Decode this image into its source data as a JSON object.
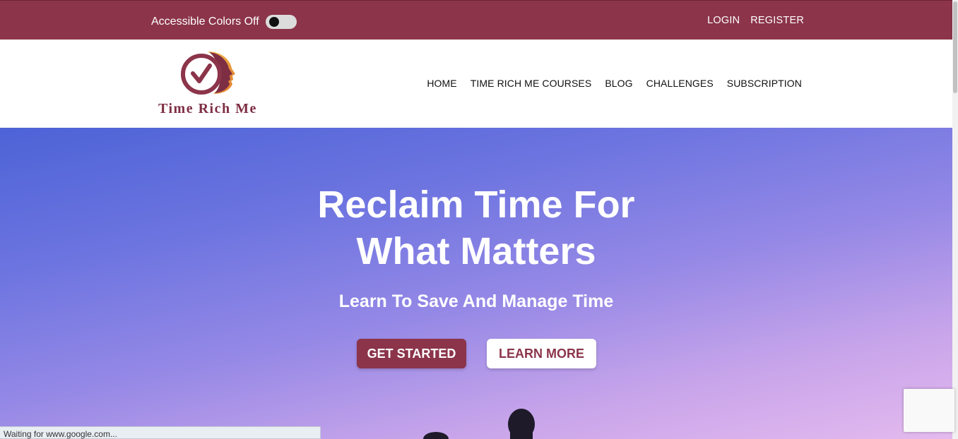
{
  "topbar": {
    "accessible_colors_label": "Accessible Colors Off",
    "login_label": "LOGIN",
    "register_label": "REGISTER"
  },
  "header": {
    "logo_text": "Time Rich Me",
    "nav": [
      {
        "label": "HOME"
      },
      {
        "label": "TIME RICH ME COURSES"
      },
      {
        "label": "BLOG"
      },
      {
        "label": "CHALLENGES"
      },
      {
        "label": "SUBSCRIPTION"
      }
    ]
  },
  "hero": {
    "title_line1": "Reclaim Time For",
    "title_line2": "What Matters",
    "subtitle": "Learn To Save And Manage Time",
    "primary_button": "GET STARTED",
    "secondary_button": "LEARN MORE"
  },
  "status": {
    "text": "Waiting for www.google.com..."
  },
  "colors": {
    "brand": "#8b344a",
    "hero_top": "#4d63d6",
    "hero_bottom": "#e4baee"
  }
}
